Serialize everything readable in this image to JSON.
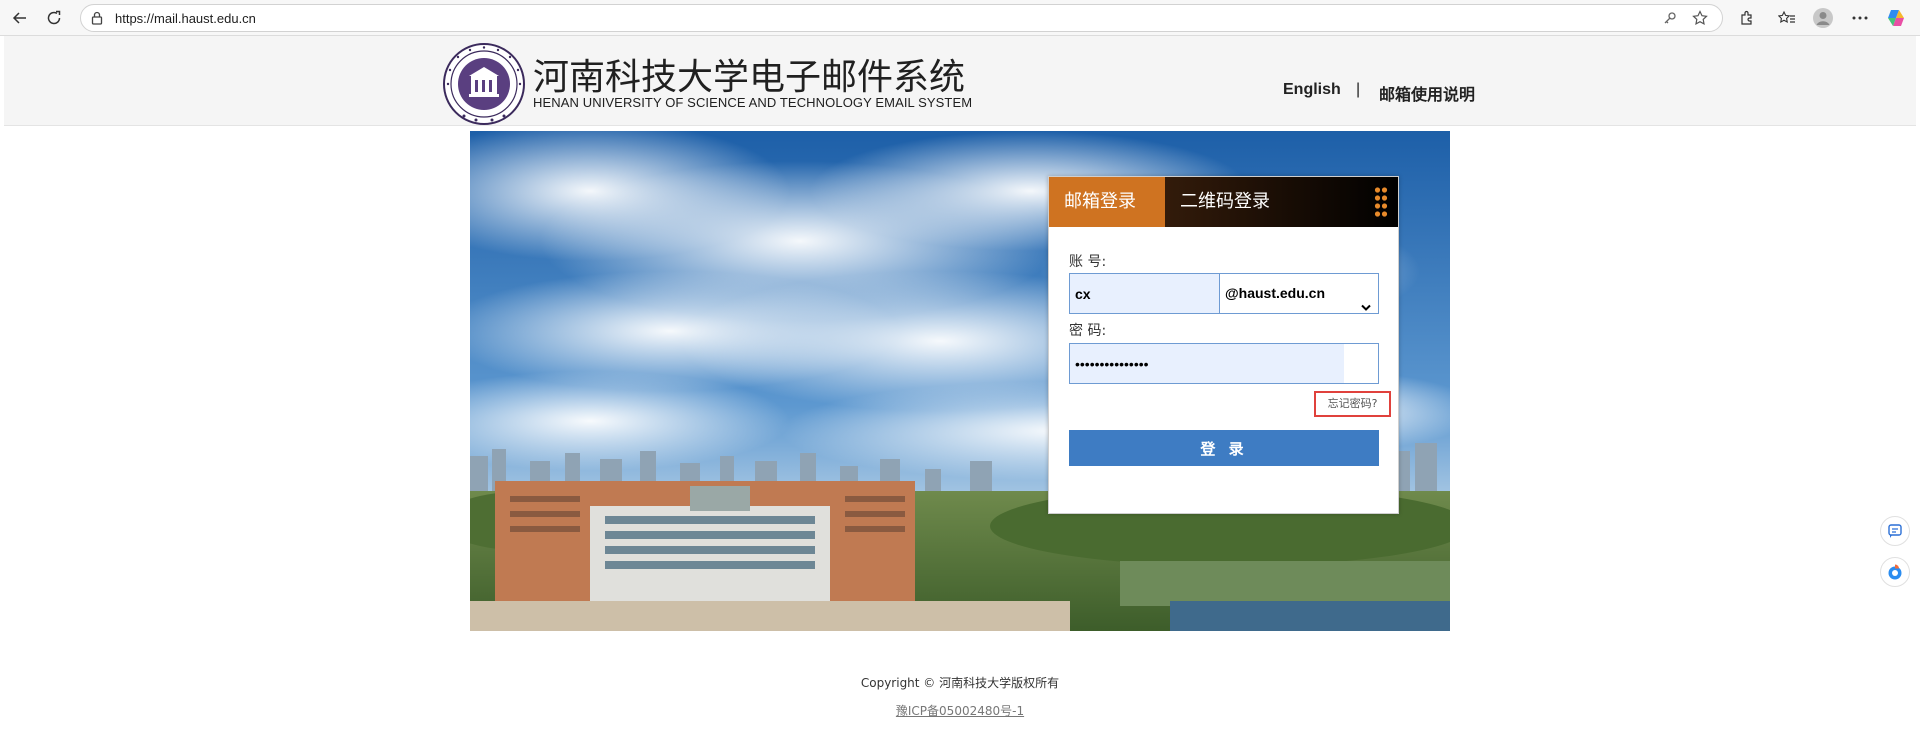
{
  "browser": {
    "url": "https://mail.haust.edu.cn"
  },
  "header": {
    "title_cn": "河南科技大学电子邮件系统",
    "title_en": "HENAN UNIVERSITY OF SCIENCE AND TECHNOLOGY EMAIL SYSTEM",
    "links": {
      "english": "English",
      "separator": "|",
      "help": "邮箱使用说明"
    }
  },
  "login": {
    "tabs": {
      "mail_login": "邮箱登录",
      "qr_login": "二维码登录"
    },
    "account_label": "账 号:",
    "account_value": "cx",
    "domain_selected": "@haust.edu.cn",
    "password_label": "密 码:",
    "password_value": "•••••••••••••••",
    "forgot_password": "忘记密码?",
    "login_button": "登 录"
  },
  "footer": {
    "copyright": "Copyright © 河南科技大学版权所有",
    "icp": "豫ICP备05002480号-1"
  },
  "colors": {
    "tab_active": "#cf7321",
    "login_button": "#3e7cc3",
    "forgot_highlight": "#e0413c"
  },
  "icons": {
    "back": "back-arrow-icon",
    "reload": "reload-icon",
    "lock": "lock-icon",
    "key": "key-icon",
    "favorite": "star-icon",
    "extensions": "puzzle-icon",
    "favorites_bar": "favorites-icon",
    "profile": "profile-icon",
    "more": "more-icon",
    "copilot": "copilot-icon"
  }
}
